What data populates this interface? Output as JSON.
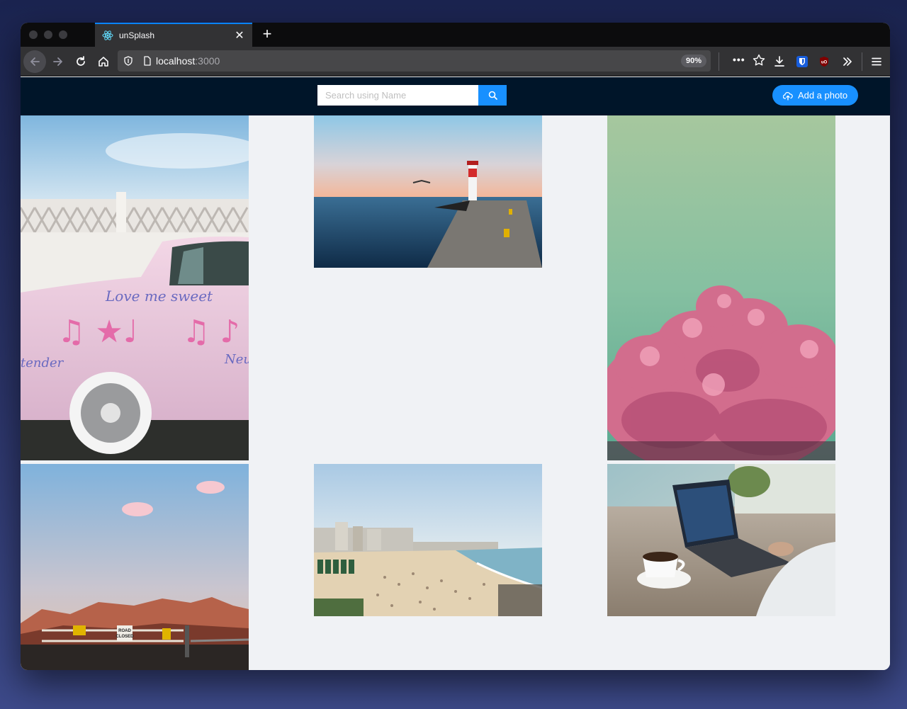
{
  "browser": {
    "tab_title": "unSplash",
    "url_host": "localhost",
    "url_port": ":3000",
    "zoom": "90%",
    "more_label": "•••"
  },
  "header": {
    "search_placeholder": "Search using Name",
    "add_button_label": "Add a photo",
    "colors": {
      "background": "#001529",
      "primary": "#1890ff"
    }
  },
  "gallery": {
    "photos": [
      {
        "subject": "pink car with 'Love me sweet' lettering",
        "sign_text_1": "Love me sweet",
        "sign_text_2": "tender",
        "sign_text_3": "Neu"
      },
      {
        "subject": "lighthouse pier at sunset"
      },
      {
        "subject": "pink blossom tree against green sky"
      },
      {
        "subject": "desert mountains with road closed gate",
        "sign_text_1": "ROAD",
        "sign_text_2": "CLOSED"
      },
      {
        "subject": "crowded beach with city skyline"
      },
      {
        "subject": "laptop and coffee cup on wooden table"
      }
    ]
  }
}
